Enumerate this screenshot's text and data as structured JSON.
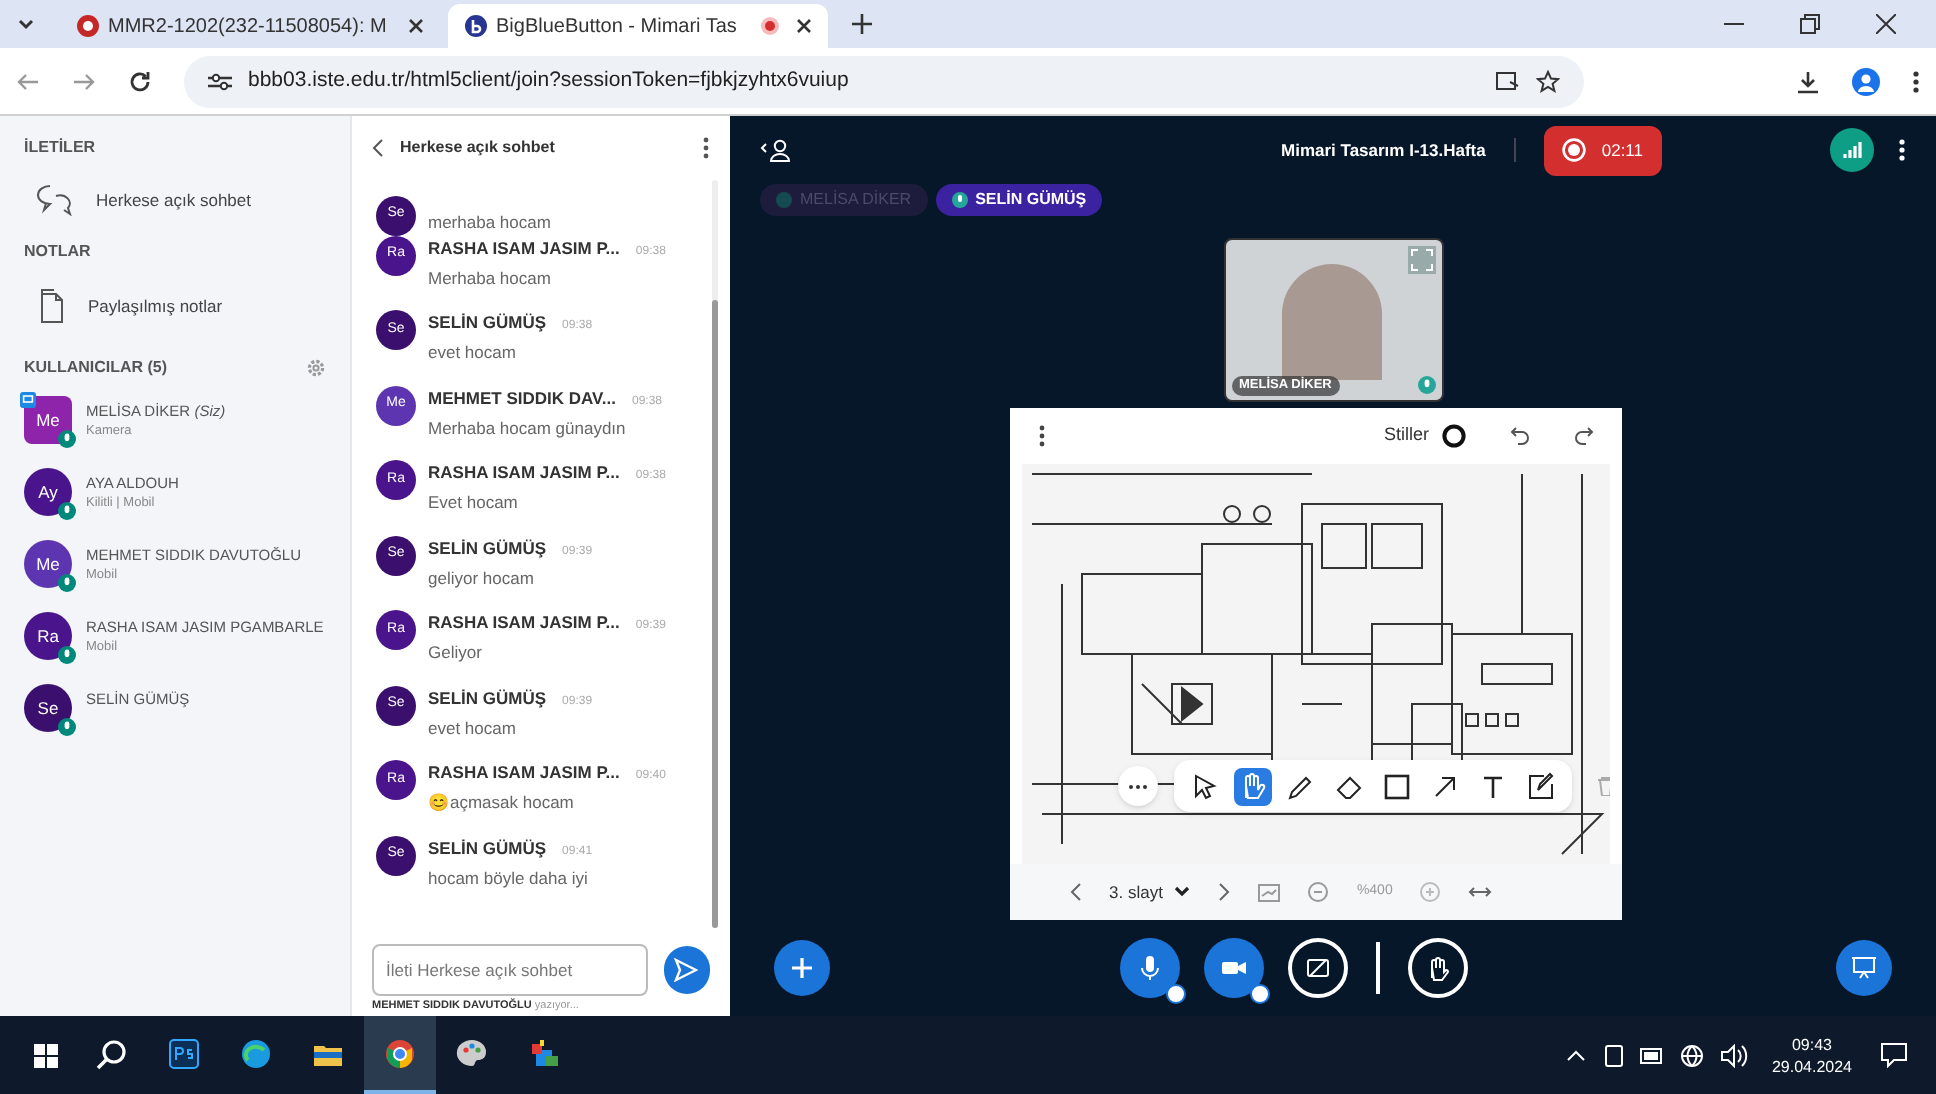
{
  "browser": {
    "tabs": [
      {
        "title": "MMR2-1202(232-11508054): M",
        "selected": false,
        "recording": false
      },
      {
        "title": "BigBlueButton - Mimari Tas",
        "selected": true,
        "recording": true
      }
    ],
    "url": "bbb03.iste.edu.tr/html5client/join?sessionToken=fjbkjzyhtx6vuiup"
  },
  "sidebar": {
    "messages_heading": "İLETİLER",
    "public_chat": "Herkese açık sohbet",
    "notes_heading": "NOTLAR",
    "shared_notes": "Paylaşılmış notlar",
    "users_heading": "KULLANICILAR (5)",
    "users": [
      {
        "initials": "Me",
        "name": "MELİSA DİKER",
        "you": "(Siz)",
        "status": "Kamera",
        "color": "#8e24aa",
        "presenter": true
      },
      {
        "initials": "Ay",
        "name": "AYA ALDOUH",
        "status": "Kilitli | Mobil",
        "color": "#4a148c",
        "presenter": false
      },
      {
        "initials": "Me",
        "name": "MEHMET SIDDIK DAVUTOĞLU",
        "status": "Mobil",
        "color": "#5e35b1",
        "presenter": false
      },
      {
        "initials": "Ra",
        "name": "RASHA ISAM JASIM PGAMBARLE",
        "status": "Mobil",
        "color": "#4a148c",
        "presenter": false
      },
      {
        "initials": "Se",
        "name": "SELİN GÜMÜŞ",
        "color": "#3a0f6e",
        "presenter": false
      }
    ]
  },
  "chat": {
    "title": "Herkese açık sohbet",
    "messages": [
      {
        "initials": "Se",
        "color": "#3a0f6e",
        "text": "merhaba hocam"
      },
      {
        "initials": "Ra",
        "color": "#4a148c",
        "author": "RASHA ISAM JASIM P...",
        "time": "09:38",
        "text": "Merhaba hocam"
      },
      {
        "initials": "Se",
        "color": "#3a0f6e",
        "author": "SELİN GÜMÜŞ",
        "time": "09:38",
        "text": "evet hocam"
      },
      {
        "initials": "Me",
        "color": "#5e35b1",
        "author": "MEHMET SIDDIK DAV...",
        "time": "09:38",
        "text": "Merhaba hocam günaydın"
      },
      {
        "initials": "Ra",
        "color": "#4a148c",
        "author": "RASHA ISAM JASIM P...",
        "time": "09:38",
        "text": "Evet hocam"
      },
      {
        "initials": "Se",
        "color": "#3a0f6e",
        "author": "SELİN GÜMÜŞ",
        "time": "09:39",
        "text": "geliyor hocam"
      },
      {
        "initials": "Ra",
        "color": "#4a148c",
        "author": "RASHA ISAM JASIM P...",
        "time": "09:39",
        "text": "Geliyor"
      },
      {
        "initials": "Se",
        "color": "#3a0f6e",
        "author": "SELİN GÜMÜŞ",
        "time": "09:39",
        "text": "evet hocam"
      },
      {
        "initials": "Ra",
        "color": "#4a148c",
        "author": "RASHA ISAM JASIM P...",
        "time": "09:40",
        "text": "😊açmasak hocam"
      },
      {
        "initials": "Se",
        "color": "#3a0f6e",
        "author": "SELİN GÜMÜŞ",
        "time": "09:41",
        "text": "hocam böyle daha iyi"
      }
    ],
    "input_placeholder": "İleti Herkese açık sohbet",
    "typing_name": "MEHMET SIDDIK DAVUTOĞLU",
    "typing_text": "yazıyor..."
  },
  "meeting": {
    "title": "Mimari Tasarım I-13.Hafta",
    "recording_time": "02:11",
    "talkers": [
      {
        "name": "MELİSA DİKER",
        "active": false
      },
      {
        "name": "SELİN GÜMÜŞ",
        "active": true
      }
    ],
    "video": {
      "name": "MELİSA DİKER"
    },
    "whiteboard": {
      "styles_label": "Stiller",
      "tools": [
        {
          "kind": "select",
          "selected": false
        },
        {
          "kind": "hand",
          "selected": true
        },
        {
          "kind": "pencil",
          "selected": false
        },
        {
          "kind": "eraser",
          "selected": false
        },
        {
          "kind": "rectangle",
          "selected": false
        },
        {
          "kind": "arrow",
          "selected": false
        },
        {
          "kind": "text",
          "selected": false
        },
        {
          "kind": "note",
          "selected": false
        }
      ],
      "slide": "3. slayt",
      "zoom": "%400"
    }
  },
  "taskbar": {
    "apps": [
      {
        "kind": "search",
        "active": false
      },
      {
        "kind": "photoshop",
        "active": false
      },
      {
        "kind": "edge",
        "active": false
      },
      {
        "kind": "files",
        "active": false
      },
      {
        "kind": "chrome",
        "active": true
      },
      {
        "kind": "paint",
        "active": false
      },
      {
        "kind": "app",
        "active": false
      }
    ],
    "time": "09:43",
    "date": "29.04.2024"
  }
}
